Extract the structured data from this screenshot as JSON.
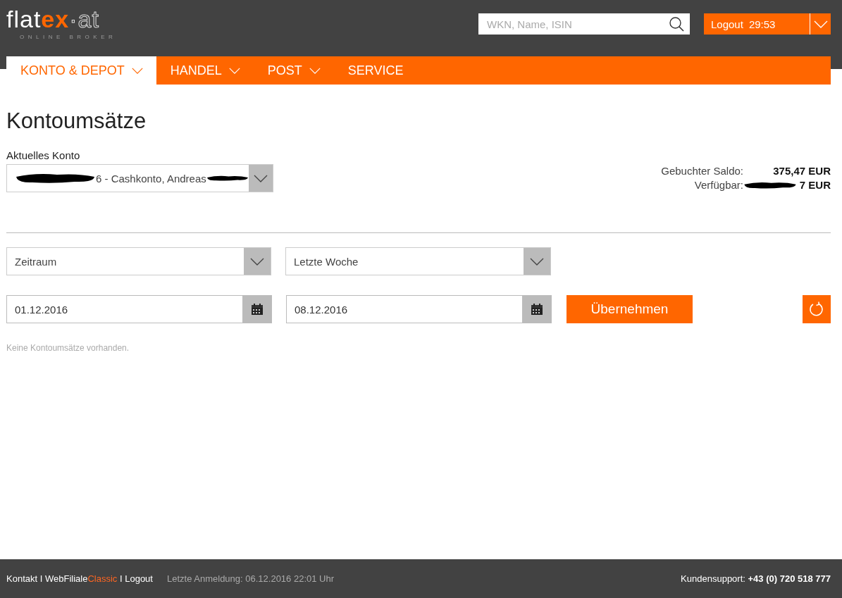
{
  "logo": {
    "main": "flat",
    "accent": "ex",
    "suffix": "·at",
    "tagline": "ONLINE BROKER"
  },
  "search": {
    "placeholder": "WKN, Name, ISIN"
  },
  "session": {
    "label": "Logout",
    "timer": "29:53"
  },
  "nav": [
    {
      "label": "KONTO & DEPOT",
      "selected": true,
      "has_menu": true
    },
    {
      "label": "HANDEL",
      "selected": false,
      "has_menu": true
    },
    {
      "label": "POST",
      "selected": false,
      "has_menu": true
    },
    {
      "label": "SERVICE",
      "selected": false,
      "has_menu": false
    }
  ],
  "page_title": "Kontoumsätze",
  "account": {
    "label": "Aktuelles Konto",
    "value": "6 - Cashkonto, Andreas"
  },
  "balances": [
    {
      "label": "Gebuchter Saldo:",
      "value": "375,47 EUR",
      "redacted": false
    },
    {
      "label": "Verfügbar:",
      "value": "7 EUR",
      "redacted": true
    }
  ],
  "filters": [
    {
      "value": "Zeitraum"
    },
    {
      "value": "Letzte Woche"
    }
  ],
  "dates": [
    {
      "value": "01.12.2016"
    },
    {
      "value": "08.12.2016"
    }
  ],
  "apply_button": "Übernehmen",
  "empty_message": "Keine Kontoumsätze vorhanden.",
  "footer": {
    "items": [
      {
        "kind": "link",
        "label": "Kontakt"
      },
      {
        "kind": "separator",
        "label": "I"
      },
      {
        "kind": "link",
        "label": "WebFiliale",
        "accent": "Classic"
      },
      {
        "kind": "separator",
        "label": "I"
      },
      {
        "kind": "link",
        "label": "Logout"
      }
    ],
    "last_login": "Letzte Anmeldung: 06.12.2016 22:01 Uhr",
    "support_label": "Kundensupport:",
    "support_phone": "+43 (0) 720 518 777"
  }
}
